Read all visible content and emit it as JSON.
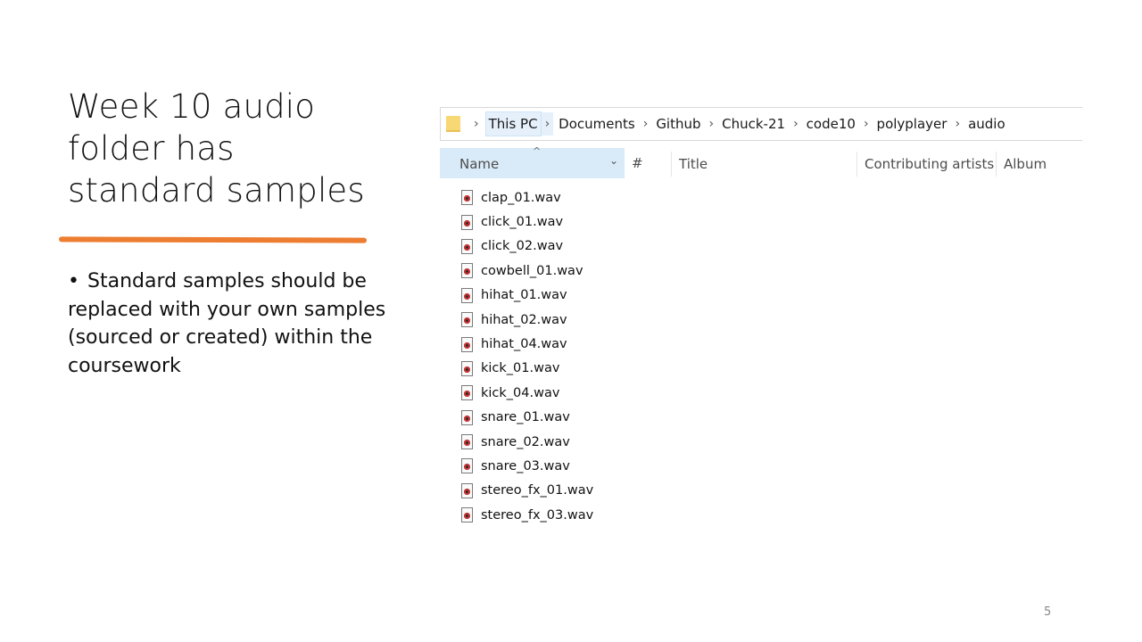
{
  "slide": {
    "title": "Week 10 audio folder has standard samples",
    "bullets": [
      "Standard samples should be replaced with your own samples (sourced or created) within the coursework"
    ],
    "page_number": "5",
    "accent_color": "#ed7d31"
  },
  "explorer": {
    "breadcrumb": [
      "This PC",
      "Documents",
      "Github",
      "Chuck-21",
      "code10",
      "polyplayer",
      "audio"
    ],
    "columns": {
      "name": "Name",
      "number": "#",
      "title": "Title",
      "artists": "Contributing artists",
      "album": "Album"
    },
    "files": [
      "clap_01.wav",
      "click_01.wav",
      "click_02.wav",
      "cowbell_01.wav",
      "hihat_01.wav",
      "hihat_02.wav",
      "hihat_04.wav",
      "kick_01.wav",
      "kick_04.wav",
      "snare_01.wav",
      "snare_02.wav",
      "snare_03.wav",
      "stereo_fx_01.wav",
      "stereo_fx_03.wav"
    ]
  }
}
